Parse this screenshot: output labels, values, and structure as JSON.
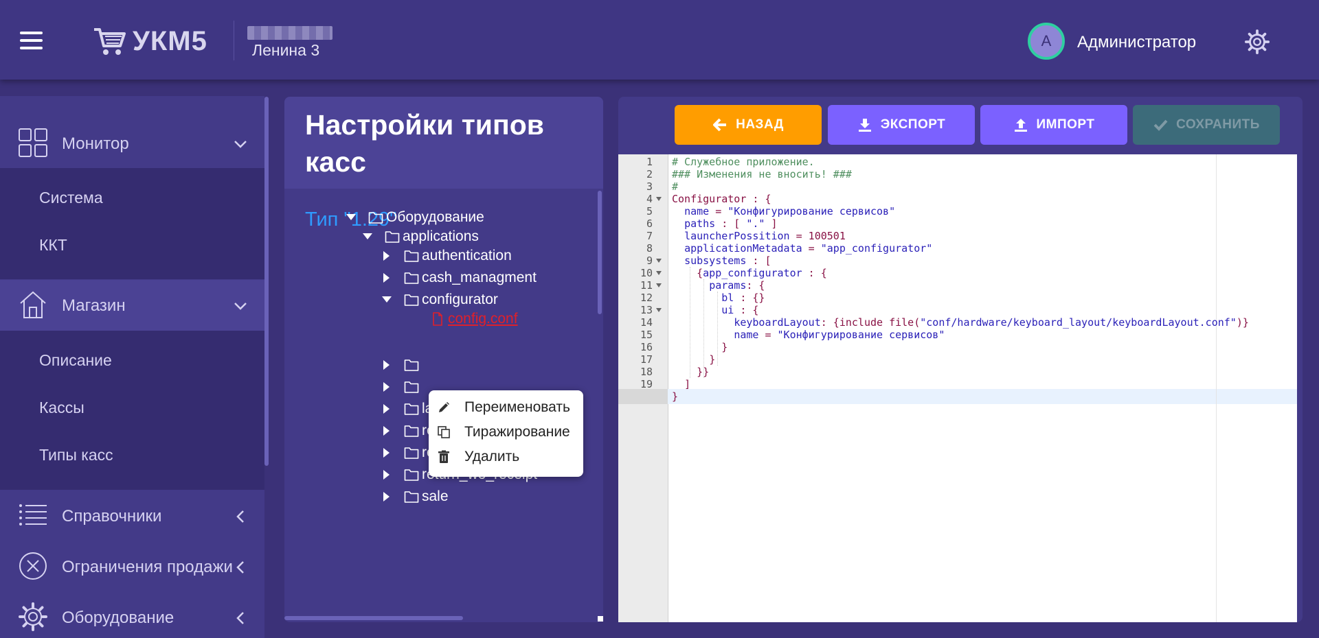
{
  "header": {
    "logo_text": "УКМ5",
    "store_name": "Ленина 3",
    "avatar_letter": "А",
    "username": "Администратор"
  },
  "sidebar": {
    "monitor": {
      "label": "Монитор",
      "items": [
        "Система",
        "ККТ"
      ]
    },
    "shop": {
      "label": "Магазин",
      "items": [
        "Описание",
        "Кассы",
        "Типы касс"
      ]
    },
    "groups": [
      "Справочники",
      "Ограничения продажи",
      "Оборудование"
    ]
  },
  "middle": {
    "title": "Настройки типов касс",
    "type_label": "Тип \"1.29\"",
    "tree": [
      {
        "label": "Оборудование",
        "state": "expanded"
      },
      {
        "label": "applications",
        "state": "expanded"
      },
      {
        "label": "authentication",
        "state": "collapsed"
      },
      {
        "label": "cash_managment",
        "state": "collapsed"
      },
      {
        "label": "configurator",
        "state": "expanded"
      },
      {
        "label": "config.conf",
        "state": "file"
      },
      {
        "label": "",
        "state": "collapsed"
      },
      {
        "label": "",
        "state": "collapsed"
      },
      {
        "label": "launcher",
        "state": "collapsed"
      },
      {
        "label": "reports",
        "state": "collapsed"
      },
      {
        "label": "return_by_receipt",
        "state": "collapsed"
      },
      {
        "label": "return_wo_receipt",
        "state": "collapsed"
      },
      {
        "label": "sale",
        "state": "collapsed"
      }
    ],
    "context_menu": [
      "Переименовать",
      "Тиражирование",
      "Удалить"
    ]
  },
  "toolbar": {
    "back": "НАЗАД",
    "export": "ЭКСПОРТ",
    "import": "ИМПОРТ",
    "save": "СОХРАНИТЬ"
  },
  "colors": {
    "back_button": "#ff9d00",
    "action_button": "#7b61ff",
    "save_button_disabled": "#3c6b7a",
    "type_label": "#2f9bff",
    "selected_file": "#e0202a"
  },
  "editor": {
    "active_line": 20,
    "lines": [
      "# Служебное приложение.",
      "### Изменения не вносить! ###",
      "#",
      "Configurator : {",
      "  name = \"Конфигурирование сервисов\"",
      "  paths : [ \".\" ]",
      "  launcherPossition = 100501",
      "  applicationMetadata = \"app_configurator\"",
      "  subsystems : [",
      "    {app_configurator : {",
      "      params: {",
      "        bl : {}",
      "        ui : {",
      "          keyboardLayout: {include file(\"conf/hardware/keyboard_layout/keyboardLayout.conf\")}",
      "          name = \"Конфигурирование сервисов\"",
      "        }",
      "      }",
      "    }}",
      "  ]",
      "}"
    ]
  }
}
